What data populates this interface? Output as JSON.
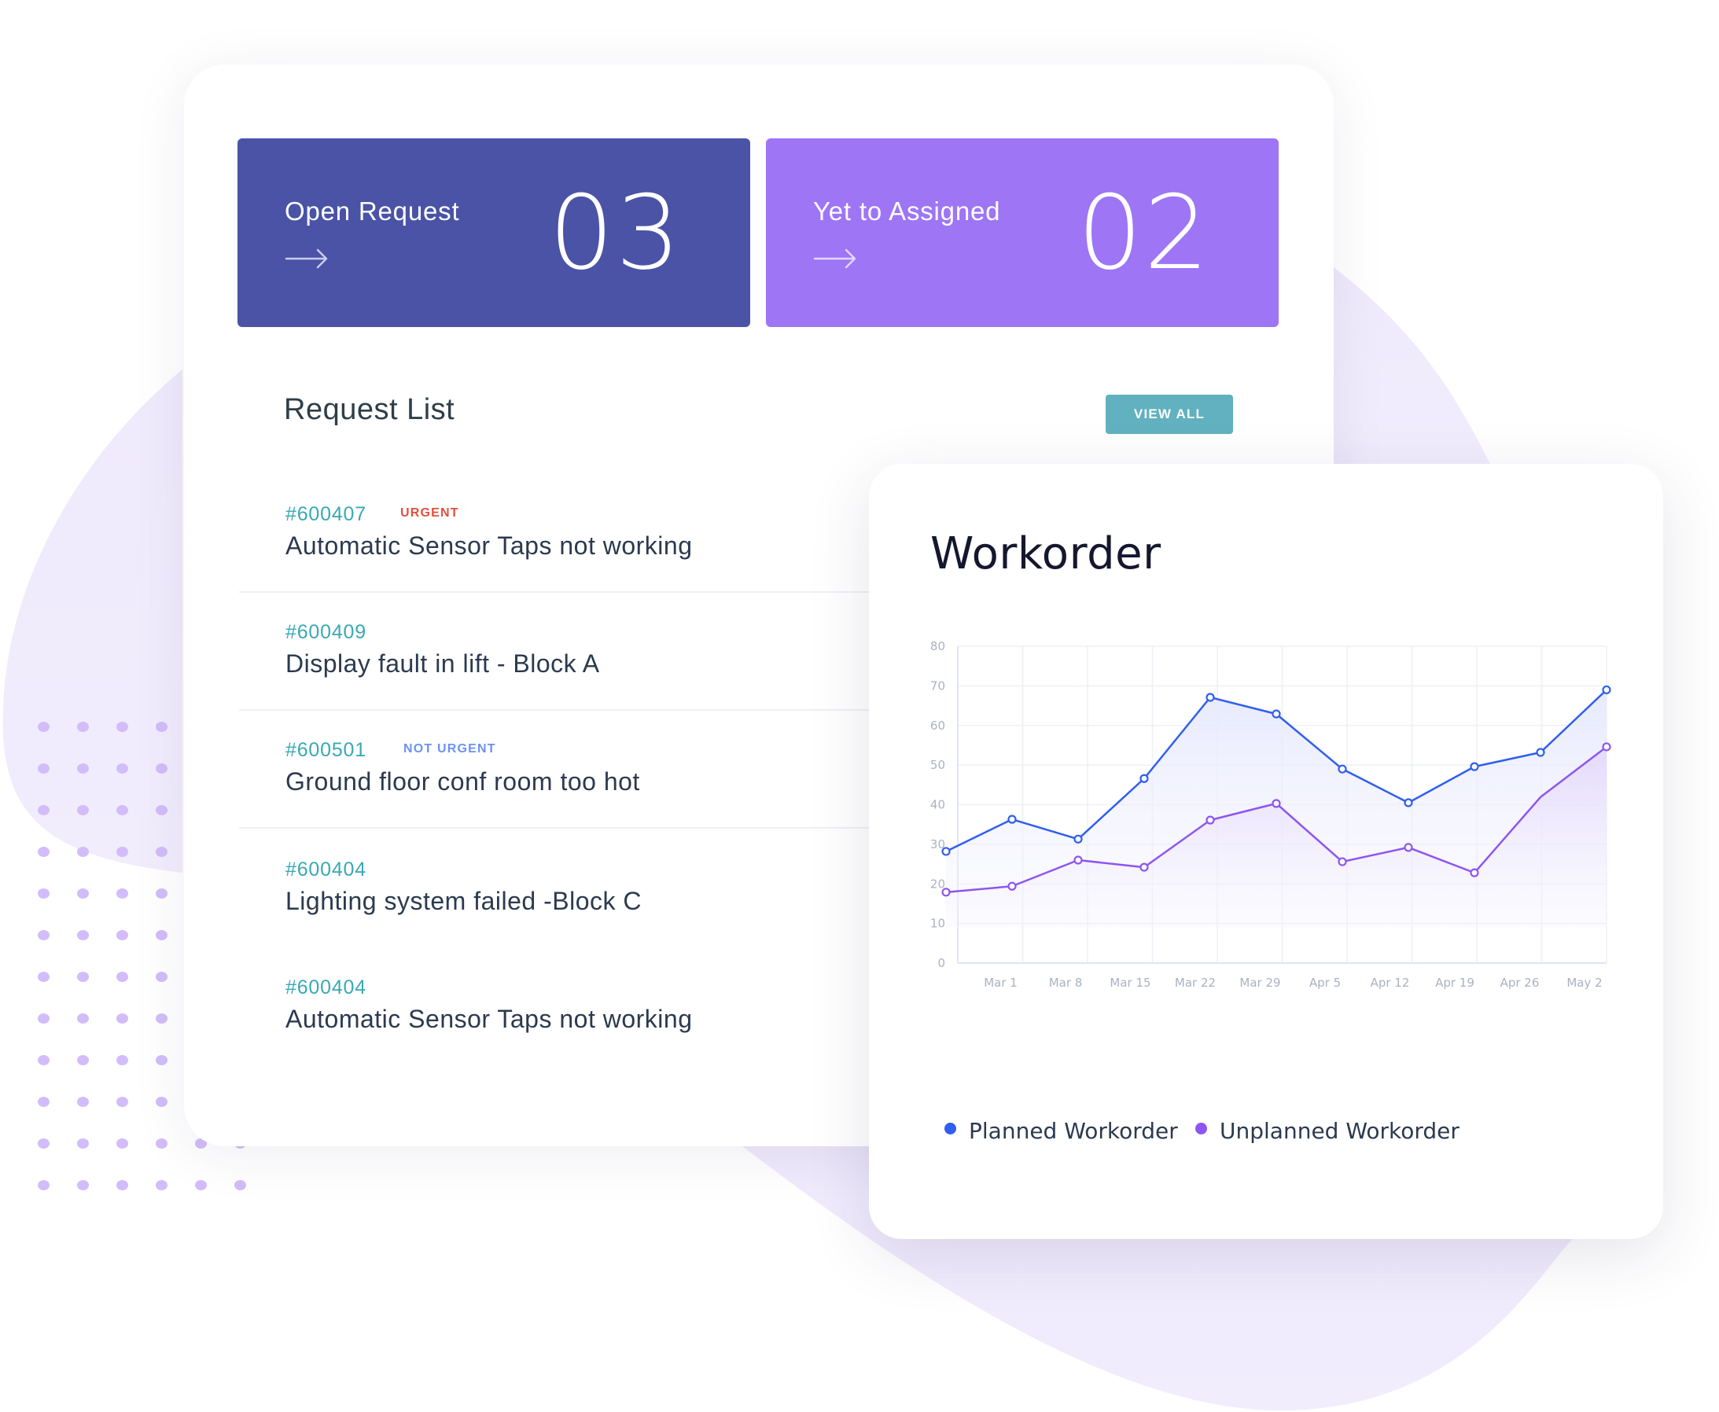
{
  "colors": {
    "open_tile": "#4a53a6",
    "pending_tile": "#9d75f5",
    "accent_teal": "#61b1c0",
    "id_teal": "#38a9b4",
    "urgent_red": "#e0503b",
    "not_urgent_blue": "#6d92f0",
    "planned_line": "#2f5ef0",
    "unplanned_line": "#8e55f0"
  },
  "stats": [
    {
      "label": "Open Request",
      "value": "03",
      "arrow_icon": "arrow-right-icon"
    },
    {
      "label": "Yet to Assigned",
      "value": "02",
      "arrow_icon": "arrow-right-icon"
    }
  ],
  "request_list": {
    "title": "Request List",
    "view_all_label": "VIEW ALL",
    "items": [
      {
        "id": "#600407",
        "badge": "URGENT",
        "badge_type": "urgent",
        "title": "Automatic Sensor Taps not working"
      },
      {
        "id": "#600409",
        "badge": "",
        "badge_type": "",
        "title": "Display fault in lift - Block A"
      },
      {
        "id": "#600501",
        "badge": "NOT URGENT",
        "badge_type": "not-urgent",
        "title": "Ground floor conf room too hot"
      },
      {
        "id": "#600404",
        "badge": "",
        "badge_type": "",
        "title": "Lighting system failed -Block C"
      },
      {
        "id": "#600404",
        "badge": "",
        "badge_type": "",
        "title": "Automatic Sensor Taps not working"
      }
    ]
  },
  "workorder": {
    "title": "Workorder"
  },
  "chart_data": {
    "type": "area",
    "title": "Workorder",
    "xlabel": "",
    "ylabel": "",
    "categories": [
      "Mar 1",
      "Mar 8",
      "Mar 15",
      "Mar 22",
      "Mar 29",
      "Apr 5",
      "Apr 12",
      "Apr 19",
      "Apr 26",
      "May 2"
    ],
    "ylim": [
      0,
      80
    ],
    "yticks": [
      "0",
      "10",
      "20",
      "30",
      "40",
      "50",
      "60",
      "70",
      "80"
    ],
    "grid": true,
    "legend_position": "bottom-left",
    "series": [
      {
        "name": "Planned Workorder",
        "color": "#2f5ef0",
        "markers": true,
        "values": [
          28.2,
          36.3,
          31.3,
          46.6,
          67.1,
          62.9,
          49.0,
          40.5,
          49.6,
          53.2,
          69.0
        ]
      },
      {
        "name": "Unplanned Workorder",
        "color": "#8e55f0",
        "markers": true,
        "values": [
          17.9,
          19.4,
          26.0,
          24.2,
          36.1,
          40.3,
          25.6,
          29.2,
          22.8,
          41.9,
          54.6
        ]
      }
    ]
  }
}
